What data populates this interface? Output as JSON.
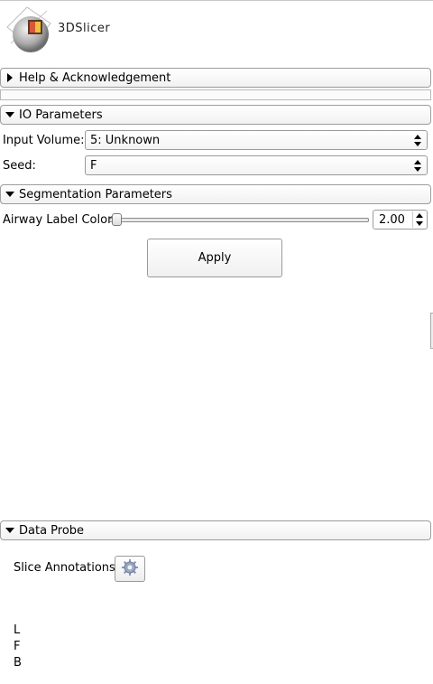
{
  "app": {
    "logo_text": "3DSlicer"
  },
  "sections": {
    "help": {
      "title": "Help & Acknowledgement",
      "expanded": false
    },
    "io": {
      "title": "IO Parameters",
      "expanded": true
    },
    "segmentation": {
      "title": "Segmentation Parameters",
      "expanded": true
    },
    "data_probe": {
      "title": "Data Probe",
      "expanded": true
    }
  },
  "io": {
    "input_volume_label": "Input Volume:",
    "input_volume_value": "5: Unknown",
    "seed_label": "Seed:",
    "seed_value": "F"
  },
  "segmentation": {
    "airway_label_color_label": "Airway Label Color",
    "airway_label_color_value": "2.00"
  },
  "apply_button": {
    "label": "Apply"
  },
  "data_probe": {
    "slice_annotations_label": "Slice Annotations:",
    "lines": [
      "L",
      "F",
      "B"
    ]
  },
  "icons": {
    "section_collapsed": "triangle-right-icon",
    "section_expanded": "triangle-down-icon",
    "combo_arrows": "up-down-arrows-icon",
    "slice_annotations": "gear-icon"
  }
}
